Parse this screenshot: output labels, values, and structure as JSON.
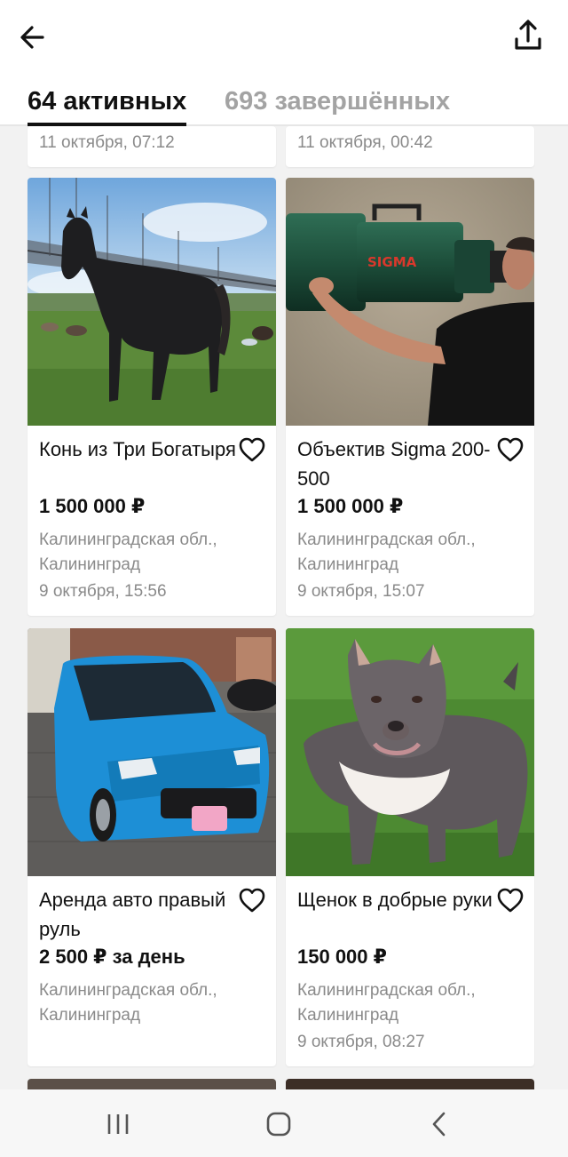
{
  "header": {
    "back_icon": "arrow-left-icon",
    "share_icon": "share-upload-icon"
  },
  "tabs": {
    "active_label": "64 активных",
    "inactive_label": "693 завершённых"
  },
  "partial_cards": [
    {
      "date": "11 октября, 07:12"
    },
    {
      "date": "11 октября, 00:42"
    }
  ],
  "listings": [
    {
      "title": "Конь из Три Богатыря",
      "price": "1 500 000 ₽",
      "location": "Калининградская обл., Калининград",
      "date": "9 октября, 15:56",
      "image": "horse-photo"
    },
    {
      "title": "Объектив Sigma 200-500",
      "price": "1 500 000 ₽",
      "location": "Калининградская обл., Калининград",
      "date": "9 октября, 15:07",
      "image": "lens-photo",
      "lens_brand": "SIGMA"
    },
    {
      "title": "Аренда авто правый руль",
      "price": "2 500 ₽ за день",
      "location": "Калининградская обл., Калининград",
      "date": "",
      "image": "car-photo"
    },
    {
      "title": "Щенок в добрые руки",
      "price": "150 000 ₽",
      "location": "Калининградская обл., Калининград",
      "date": "9 октября, 08:27",
      "image": "dog-photo"
    }
  ],
  "colors": {
    "accent": "#111111",
    "muted_text": "#8a8a8a",
    "inactive_tab": "#a3a3a3"
  },
  "system_nav": {
    "recent_icon": "recent-apps-icon",
    "home_icon": "home-icon",
    "back_icon": "nav-back-icon"
  }
}
